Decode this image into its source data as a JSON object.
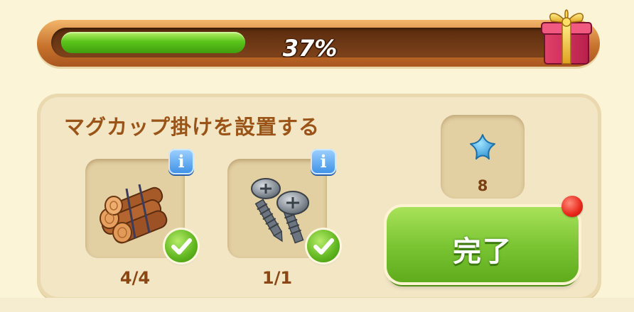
{
  "progress": {
    "percent": 37,
    "label": "37%"
  },
  "task": {
    "title": "マグカップ掛けを設置する"
  },
  "materials": [
    {
      "item": "wood-logs",
      "count_label": "4/4",
      "complete": true
    },
    {
      "item": "screws",
      "count_label": "1/1",
      "complete": true
    }
  ],
  "info_glyph": "i",
  "reward": {
    "icon": "blue-star-icon",
    "count_label": "8"
  },
  "complete_button": {
    "label": "完了"
  },
  "colors": {
    "progress_fill": "#5bc51a",
    "panel_bg": "#f2e6c5",
    "title_text": "#9a5418",
    "button_green": "#7cc634",
    "notification": "#e8271a",
    "info_blue": "#3c8fe6"
  }
}
